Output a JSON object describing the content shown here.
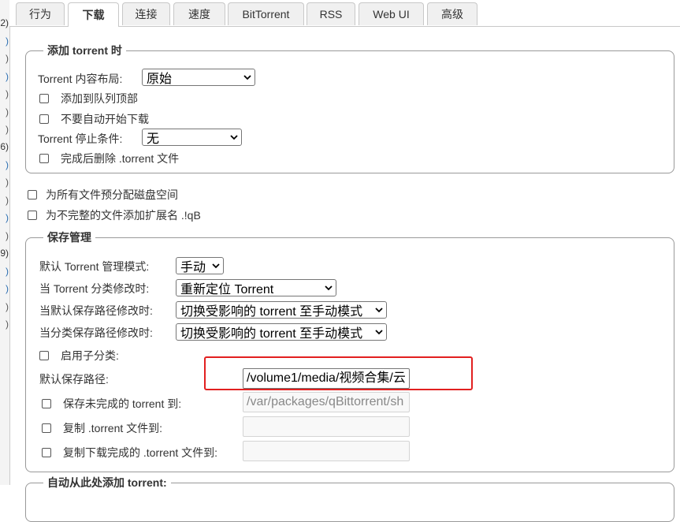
{
  "left_strip": {
    "fragments": [
      "2)",
      ")",
      ")",
      ")",
      ")",
      ")",
      ")",
      "6)",
      ")",
      ")",
      ")",
      ")",
      ")",
      "9)",
      ")",
      ")",
      ")",
      ")"
    ]
  },
  "tabs": [
    {
      "label": "行为",
      "active": false
    },
    {
      "label": "下载",
      "active": true
    },
    {
      "label": "连接",
      "active": false
    },
    {
      "label": "速度",
      "active": false
    },
    {
      "label": "BitTorrent",
      "active": false
    },
    {
      "label": "RSS",
      "active": false
    },
    {
      "label": "Web UI",
      "active": false
    },
    {
      "label": "高级",
      "active": false
    }
  ],
  "add_torrent": {
    "legend": "添加 torrent 时",
    "layout_label": "Torrent 内容布局:",
    "layout_value": "原始",
    "add_to_top_label": "添加到队列顶部",
    "dont_start_label": "不要自动开始下载",
    "stop_condition_label": "Torrent 停止条件:",
    "stop_condition_value": "无",
    "delete_torrent_label": "完成后删除 .torrent 文件"
  },
  "preallocate_label": "为所有文件预分配磁盘空间",
  "append_ext_label": "为不完整的文件添加扩展名 .!qB",
  "save_management": {
    "legend": "保存管理",
    "mgmt_mode_label": "默认 Torrent 管理模式:",
    "mgmt_mode_value": "手动",
    "category_changed_label": "当 Torrent 分类修改时:",
    "category_changed_value": "重新定位 Torrent",
    "default_path_changed_label": "当默认保存路径修改时:",
    "default_path_changed_value": "切换受影响的 torrent 至手动模式",
    "category_path_changed_label": "当分类保存路径修改时:",
    "category_path_changed_value": "切换受影响的 torrent 至手动模式",
    "subcategories_label": "启用子分类:",
    "default_save_path_label": "默认保存路径:",
    "default_save_path_value": "/volume1/media/视频合集/云",
    "incomplete_label": "保存未完成的 torrent 到:",
    "incomplete_value": "/var/packages/qBittorrent/sh",
    "copy_torrent_label": "复制 .torrent 文件到:",
    "copy_torrent_value": "",
    "copy_finished_label": "复制下载完成的 .torrent 文件到:",
    "copy_finished_value": ""
  },
  "auto_add_legend": "自动从此处添加 torrent:",
  "colors": {
    "highlight": "#e22020",
    "border": "#999999",
    "tab_bg": "#f0f0f0"
  }
}
